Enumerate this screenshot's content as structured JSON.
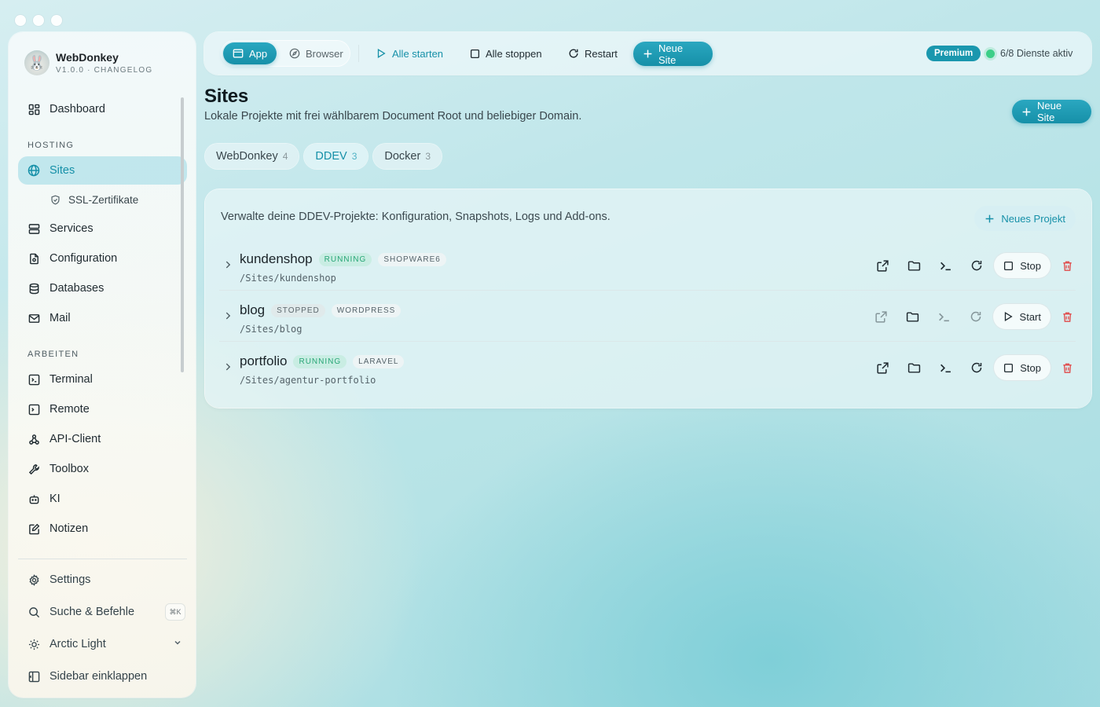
{
  "app": {
    "name": "WebDonkey",
    "version": "V1.0.0 · CHANGELOG"
  },
  "sidebar": {
    "dashboard": "Dashboard",
    "section_hosting": "HOSTING",
    "sites": "Sites",
    "ssl": "SSL-Zertifikate",
    "services": "Services",
    "configuration": "Configuration",
    "databases": "Databases",
    "mail": "Mail",
    "section_arbeiten": "ARBEITEN",
    "terminal": "Terminal",
    "remote": "Remote",
    "api_client": "API-Client",
    "toolbox": "Toolbox",
    "ki": "KI",
    "notizen": "Notizen",
    "settings": "Settings",
    "search": "Suche & Befehle",
    "search_kbd": "⌘K",
    "theme": "Arctic Light",
    "collapse": "Sidebar einklappen"
  },
  "toolbar": {
    "app": "App",
    "browser": "Browser",
    "start_all": "Alle starten",
    "stop_all": "Alle stoppen",
    "restart": "Restart",
    "new_site": "Neue Site",
    "premium": "Premium",
    "services_status": "6/8 Dienste aktiv"
  },
  "page": {
    "title": "Sites",
    "subtitle": "Lokale Projekte mit frei wählbarem Document Root und beliebiger Domain.",
    "new_site": "Neue Site"
  },
  "tabs": [
    {
      "label": "WebDonkey",
      "count": "4"
    },
    {
      "label": "DDEV",
      "count": "3"
    },
    {
      "label": "Docker",
      "count": "3"
    }
  ],
  "panel": {
    "description": "Verwalte deine DDEV-Projekte: Konfiguration, Snapshots, Logs und Add-ons.",
    "new_project": "Neues Projekt"
  },
  "projects": [
    {
      "name": "kundenshop",
      "status": "RUNNING",
      "framework": "SHOPWARE6",
      "path": "/Sites/kundenshop",
      "action": "Stop"
    },
    {
      "name": "blog",
      "status": "STOPPED",
      "framework": "WORDPRESS",
      "path": "/Sites/blog",
      "action": "Start"
    },
    {
      "name": "portfolio",
      "status": "RUNNING",
      "framework": "LARAVEL",
      "path": "/Sites/agentur-portfolio",
      "action": "Stop"
    }
  ],
  "colors": {
    "accent": "#1690a8",
    "running": "#28a676",
    "danger": "#e05252",
    "premium": "#1a97ae"
  }
}
